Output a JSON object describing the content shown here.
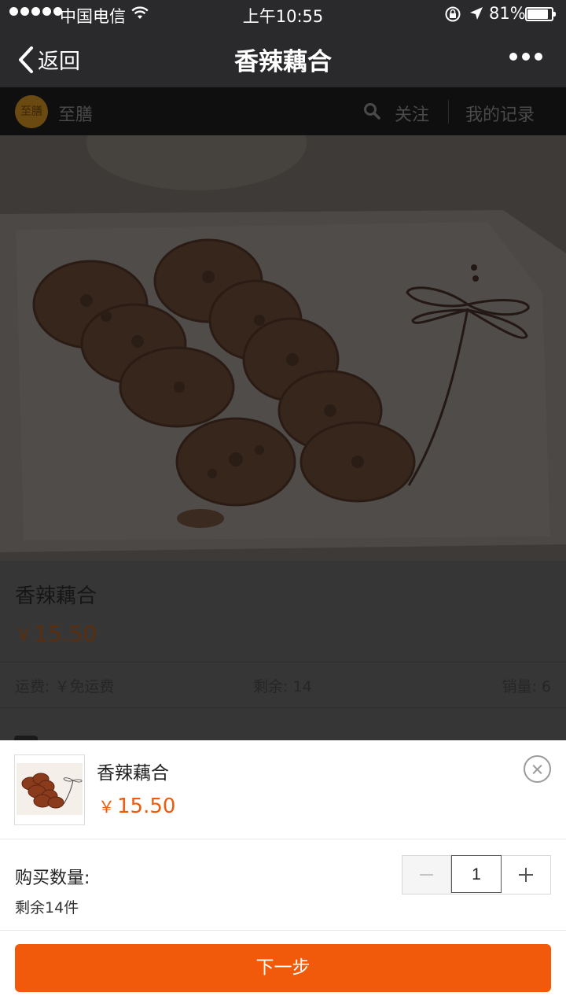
{
  "status_bar": {
    "carrier": "中国电信",
    "time": "上午10:55",
    "battery_percent": "81%",
    "battery_level": 0.81
  },
  "nav": {
    "back_label": "返回",
    "title": "香辣藕合",
    "icons": [
      "chevron-left-icon",
      "more-icon"
    ]
  },
  "shop": {
    "name": "至膳",
    "logo_text": "至膳",
    "follow_label": "关注",
    "records_label": "我的记录",
    "icons": [
      "search-icon"
    ]
  },
  "product": {
    "title": "香辣藕合",
    "currency": "￥",
    "price": "15.50",
    "shipping": "运费: ￥免运费",
    "remaining": "剩余: 14",
    "sales": "销量: 6"
  },
  "sheet": {
    "title": "香辣藕合",
    "currency": "￥",
    "price": "15.50",
    "quantity_label": "购买数量:",
    "stock_text": "剩余14件",
    "quantity": "1",
    "next_button": "下一步",
    "icons": [
      "close-icon",
      "minus-icon",
      "plus-icon"
    ]
  },
  "colors": {
    "accent": "#f15a0a",
    "nav_background": "#2a2a2c",
    "overlay": "#333333"
  }
}
